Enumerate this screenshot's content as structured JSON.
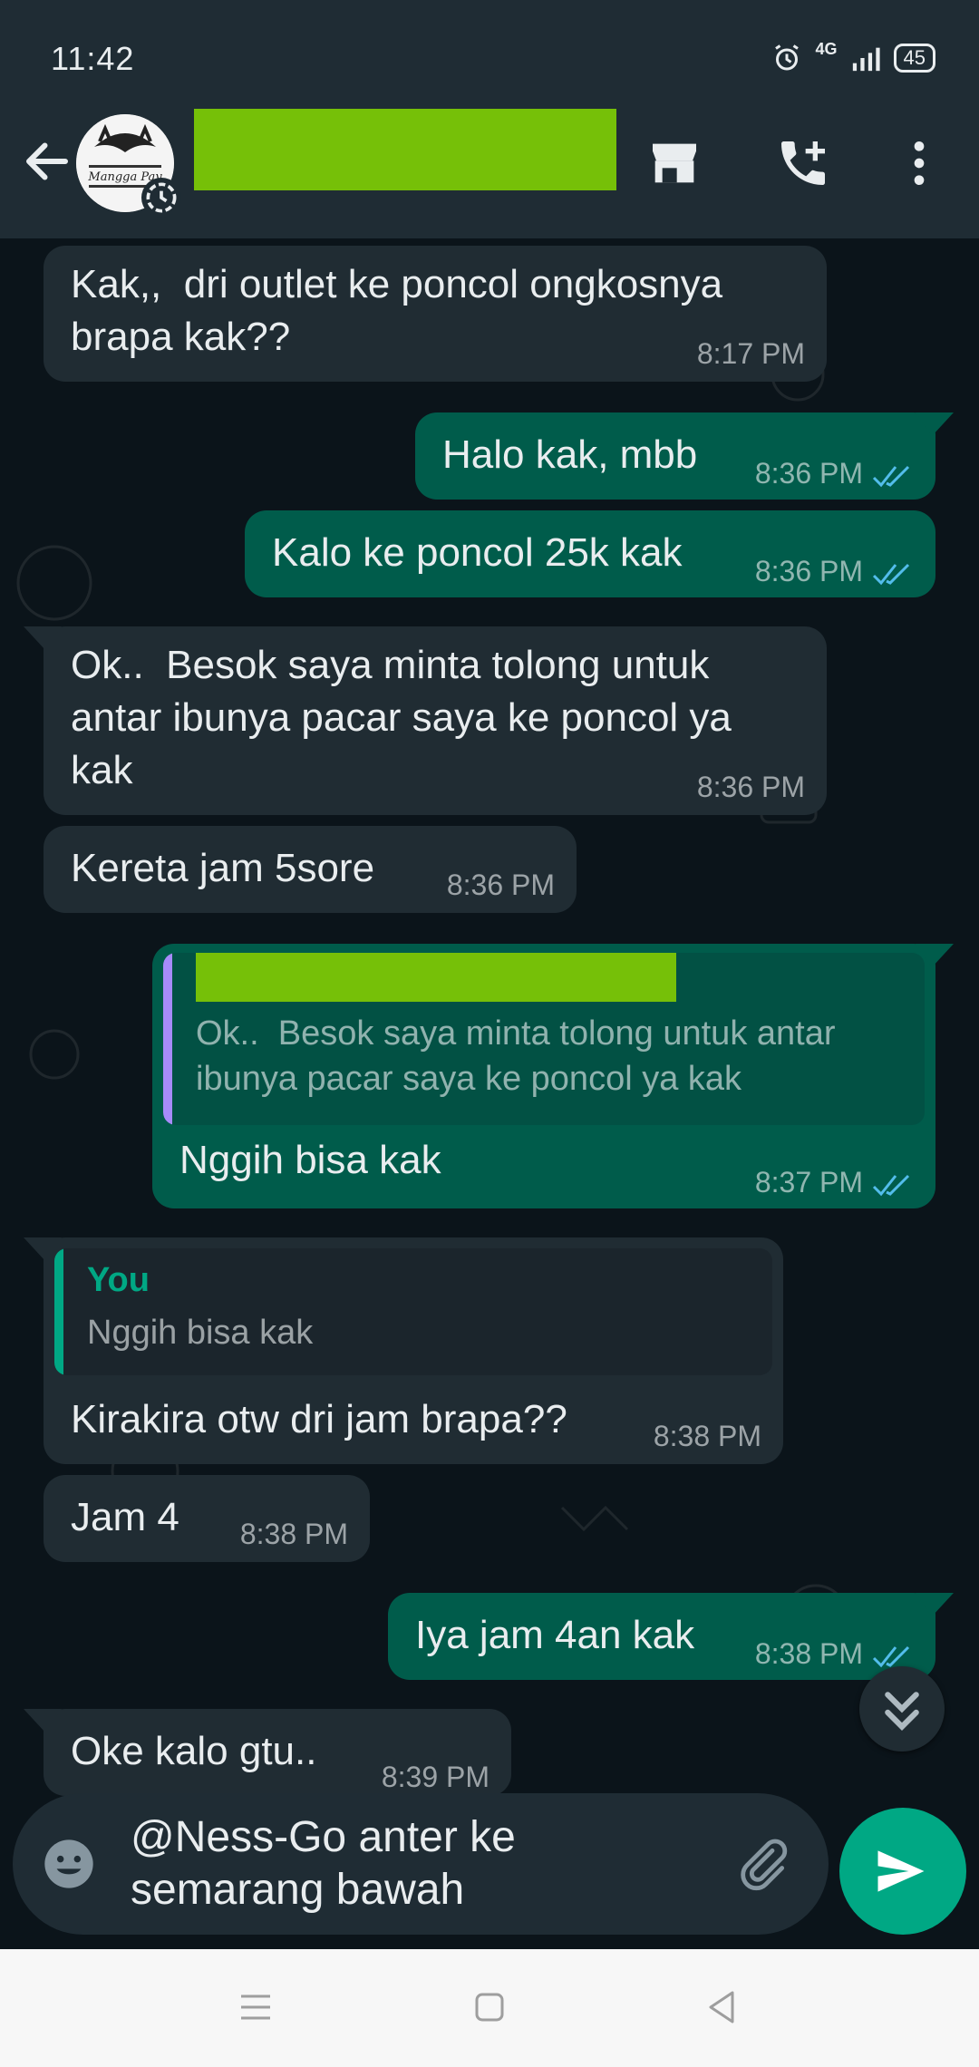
{
  "status_bar": {
    "time": "11:42",
    "network": "4G",
    "battery": "45"
  },
  "header": {
    "avatar_text": "Mangga Pay"
  },
  "messages": [
    {
      "dir": "in",
      "text": "Kak,,  dri outlet ke poncol ongkosnya\nbrapa kak??",
      "time": "8:17 PM"
    },
    {
      "dir": "out",
      "text": "Halo kak, mbb",
      "time": "8:36 PM"
    },
    {
      "dir": "out",
      "text": "Kalo ke poncol 25k kak",
      "time": "8:36 PM"
    },
    {
      "dir": "in",
      "text": "Ok..  Besok saya minta tolong untuk\nantar ibunya pacar saya ke poncol ya\nkak",
      "time": "8:36 PM"
    },
    {
      "dir": "in",
      "text": "Kereta jam 5sore",
      "time": "8:36 PM"
    },
    {
      "dir": "out",
      "text": "Nggih bisa kak",
      "time": "8:37 PM",
      "quote": {
        "text": "Ok..  Besok saya minta tolong untuk antar\nibunya pacar saya ke poncol ya kak"
      }
    },
    {
      "dir": "in",
      "text": "Kirakira otw dri jam brapa??",
      "time": "8:38 PM",
      "quote": {
        "author": "You",
        "text": "Nggih bisa kak"
      }
    },
    {
      "dir": "in",
      "text": "Jam 4",
      "time": "8:38 PM"
    },
    {
      "dir": "out",
      "text": "Iya jam 4an kak",
      "time": "8:38 PM"
    },
    {
      "dir": "in",
      "text": "Oke kalo gtu..",
      "time": "8:39 PM"
    }
  ],
  "composer": {
    "text": "@Ness-Go anter ke\nsemarang bawah"
  },
  "colors": {
    "incoming": "#202c33",
    "outgoing": "#005c4b",
    "accent": "#00a884",
    "tick_read": "#53bdeb",
    "redaction": "#76c008"
  }
}
